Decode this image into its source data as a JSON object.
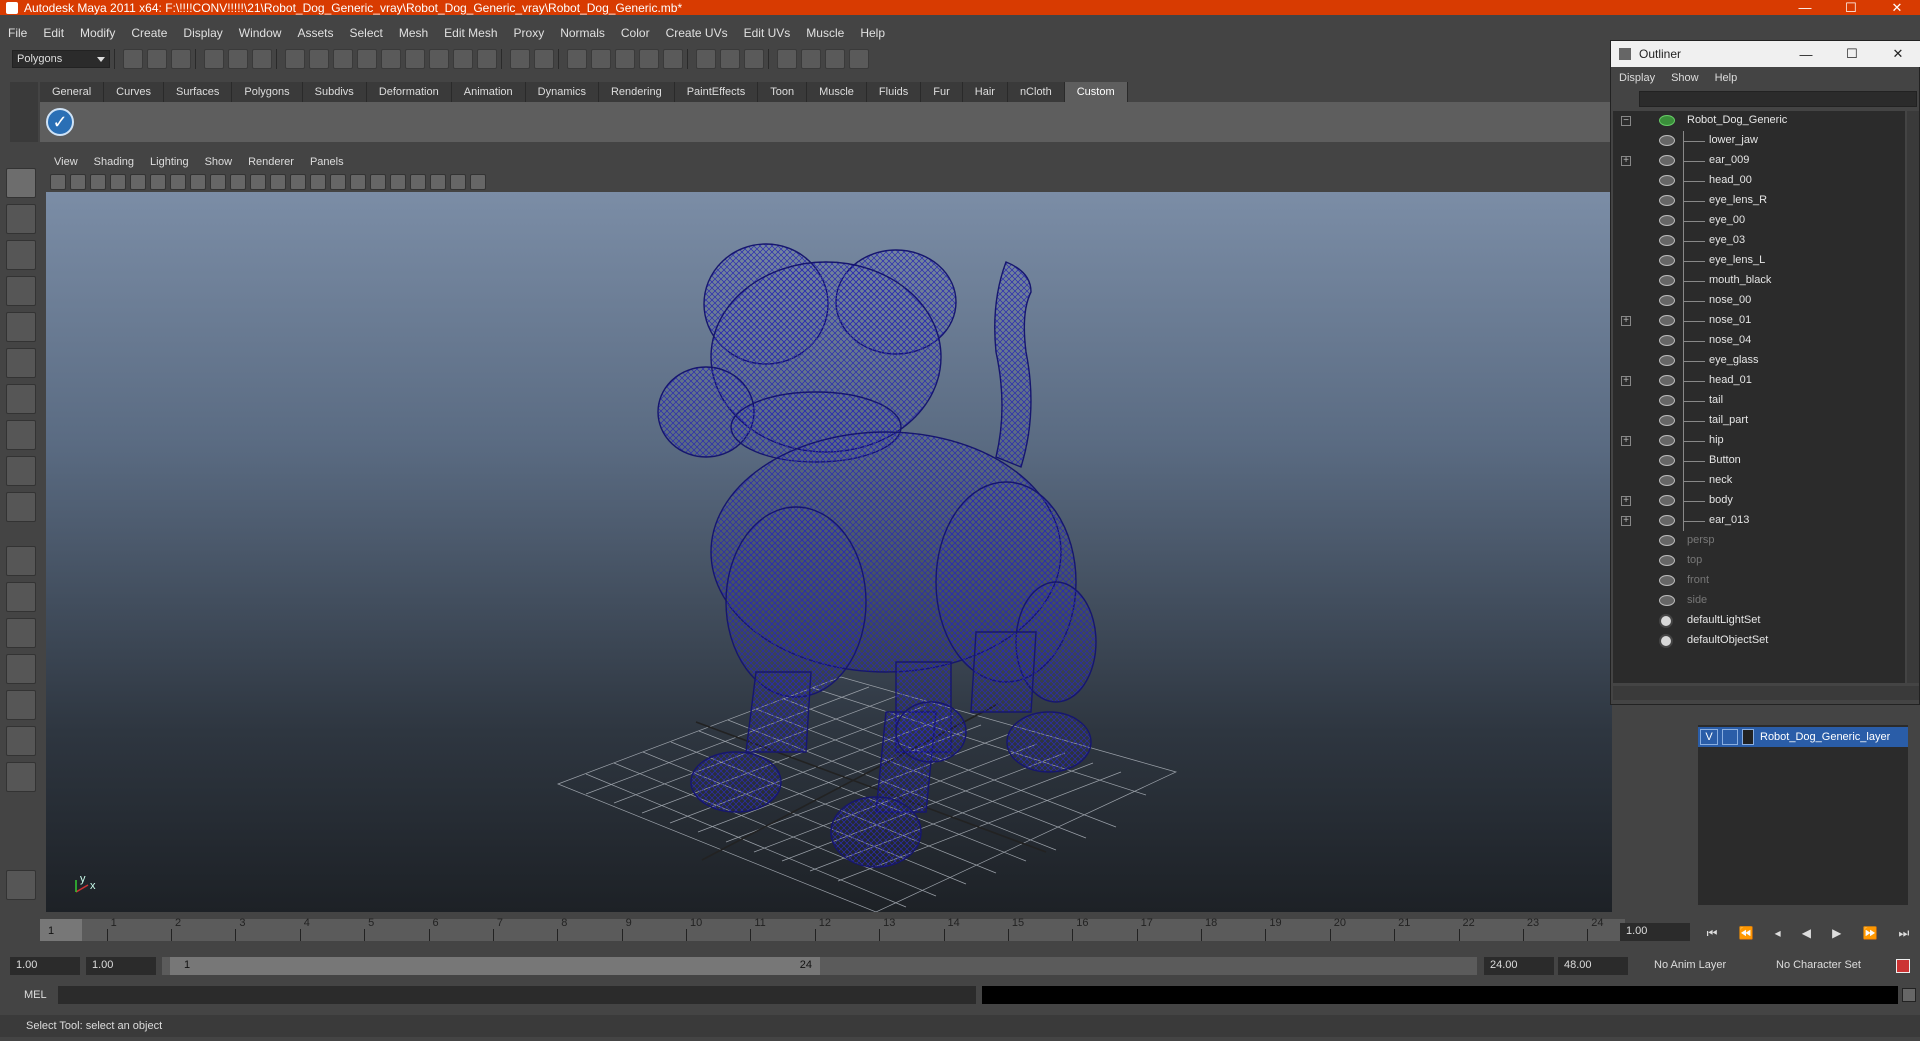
{
  "window": {
    "title": "Autodesk Maya 2011 x64: F:\\!!!!CONV!!!!!\\21\\Robot_Dog_Generic_vray\\Robot_Dog_Generic_vray\\Robot_Dog_Generic.mb*",
    "minimize": "—",
    "maximize": "☐",
    "close": "✕"
  },
  "menubar": [
    "File",
    "Edit",
    "Modify",
    "Create",
    "Display",
    "Window",
    "Assets",
    "Select",
    "Mesh",
    "Edit Mesh",
    "Proxy",
    "Normals",
    "Color",
    "Create UVs",
    "Edit UVs",
    "Muscle",
    "Help"
  ],
  "statusline": {
    "mode": "Polygons"
  },
  "shelf": {
    "tabs": [
      "General",
      "Curves",
      "Surfaces",
      "Polygons",
      "Subdivs",
      "Deformation",
      "Animation",
      "Dynamics",
      "Rendering",
      "PaintEffects",
      "Toon",
      "Muscle",
      "Fluids",
      "Fur",
      "Hair",
      "nCloth",
      "Custom"
    ],
    "active_tab": "Custom"
  },
  "viewport": {
    "menu": [
      "View",
      "Shading",
      "Lighting",
      "Show",
      "Renderer",
      "Panels"
    ],
    "axis_x": "x",
    "axis_y": "y",
    "wire_color": "#1a1a7a"
  },
  "outliner": {
    "title": "Outliner",
    "menu": [
      "Display",
      "Show",
      "Help"
    ],
    "root": "Robot_Dog_Generic",
    "children": [
      "lower_jaw",
      "ear_009",
      "head_00",
      "eye_lens_R",
      "eye_00",
      "eye_03",
      "eye_lens_L",
      "mouth_black",
      "nose_00",
      "nose_01",
      "nose_04",
      "eye_glass",
      "head_01",
      "tail",
      "tail_part",
      "hip",
      "Button",
      "neck",
      "body",
      "ear_013"
    ],
    "expandable": [
      "ear_009",
      "nose_01",
      "head_01",
      "hip",
      "body",
      "ear_013"
    ],
    "cameras": [
      "persp",
      "top",
      "front",
      "side"
    ],
    "sets": [
      "defaultLightSet",
      "defaultObjectSet"
    ]
  },
  "layers": {
    "visible_flag": "V",
    "name": "Robot_Dog_Generic_layer"
  },
  "timeslider": {
    "ticks": [
      1,
      2,
      3,
      4,
      5,
      6,
      7,
      8,
      9,
      10,
      11,
      12,
      13,
      14,
      15,
      16,
      17,
      18,
      19,
      20,
      21,
      22,
      23,
      24
    ],
    "current": "1",
    "current_time_field": "1.00"
  },
  "range": {
    "start_time": "1.00",
    "playback_start": "1.00",
    "handle_start": "1",
    "handle_end": "24",
    "playback_end": "24.00",
    "end_time": "48.00",
    "anim_layer": "No Anim Layer",
    "character_set": "No Character Set"
  },
  "commandline": {
    "label": "MEL"
  },
  "helpline": {
    "text": "Select Tool: select an object"
  }
}
